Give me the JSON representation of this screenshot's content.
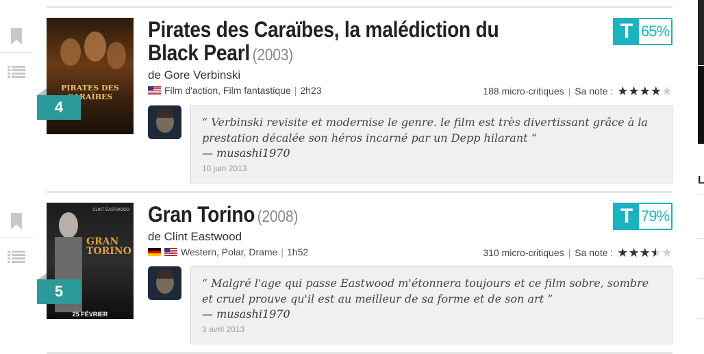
{
  "films": [
    {
      "rank": "4",
      "title": "Pirates des Caraïbes, la malédiction du Black Pearl",
      "year": "(2003)",
      "director_prefix": "de",
      "director": "Gore Verbinski",
      "genres": "Film d'action, Film fantastique",
      "duration": "2h23",
      "critiques": "188 micro-critiques",
      "note_label": "Sa note :",
      "rating": 4,
      "score_letter": "T",
      "score_pct": "65%",
      "poster_text": "PIRATES DES CARAÏBES",
      "review": "“ Verbinski revisite et modernise le genre. le film est très divertissant grâce à la prestation décalée son héros incarné par un Depp hilarant ”",
      "author": "— musashi1970",
      "date": "10 juin 2013",
      "flags": [
        "us-flag"
      ]
    },
    {
      "rank": "5",
      "title": "Gran Torino",
      "year": "(2008)",
      "director_prefix": "de",
      "director": "Clint Eastwood",
      "genres": "Western, Polar, Drame",
      "duration": "1h52",
      "critiques": "310 micro-critiques",
      "note_label": "Sa note :",
      "rating": 3.5,
      "score_letter": "T",
      "score_pct": "79%",
      "poster_top": "CLINT EASTWOOD",
      "poster_text": "GRAN TORINO",
      "poster_bottom": "25 FÉVRIER",
      "review": "“ Malgré l'age qui passe Eastwood m'étonnera toujours et ce film sobre, sombre et cruel prouve qu'il est au meilleur de sa forme et de son art ”",
      "author": "— musashi1970",
      "date": "3 avril 2013",
      "flags": [
        "de-flag",
        "us-flag"
      ]
    }
  ],
  "sidebar_letter": "L",
  "colors": {
    "accent": "#1cb2c0",
    "rank_bg": "#2a9a9a"
  }
}
